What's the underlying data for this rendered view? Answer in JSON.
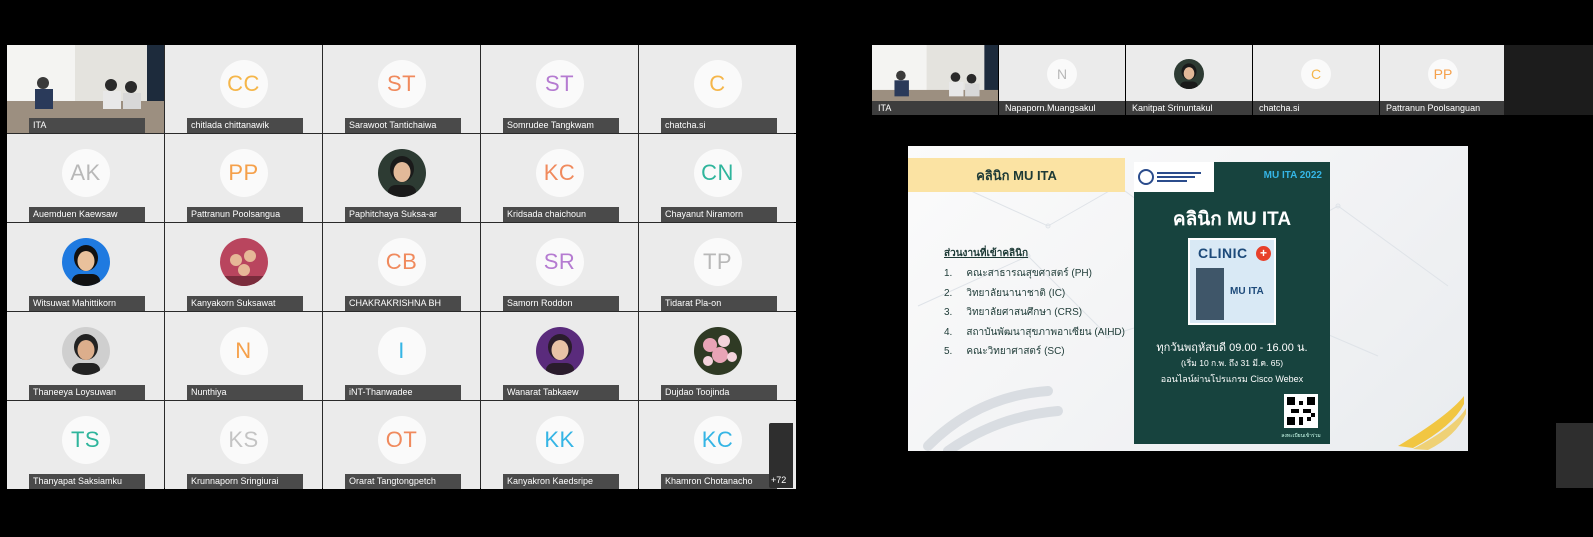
{
  "gallery": {
    "overflow_count": "+72",
    "tiles": [
      {
        "type": "video",
        "name": "ITA"
      },
      {
        "type": "initials",
        "initials": "CC",
        "color": "#f5b64a",
        "name": "chitlada chittanawik"
      },
      {
        "type": "initials",
        "initials": "ST",
        "color": "#f08a5d",
        "name": "Sarawoot Tantichaiwa"
      },
      {
        "type": "initials",
        "initials": "ST",
        "color": "#b57bd1",
        "name": "Somrudee Tangkwam"
      },
      {
        "type": "initials",
        "initials": "C",
        "color": "#f5b64a",
        "name": "chatcha.si"
      },
      {
        "type": "initials",
        "initials": "AK",
        "color": "#b8b8b8",
        "name": "Auemduen Kaewsaw"
      },
      {
        "type": "initials",
        "initials": "PP",
        "color": "#f5a04a",
        "name": "Pattranun Poolsangua"
      },
      {
        "type": "photo",
        "photo": "woman-portrait",
        "name": "Paphitchaya Suksa-ar"
      },
      {
        "type": "initials",
        "initials": "KC",
        "color": "#f08a5d",
        "name": "Kridsada chaichoun"
      },
      {
        "type": "initials",
        "initials": "CN",
        "color": "#2fb59c",
        "name": "Chayanut Niramorn"
      },
      {
        "type": "photo",
        "photo": "boy-blue-portrait",
        "name": "Witsuwat Mahittikorn"
      },
      {
        "type": "photo",
        "photo": "group-photo",
        "name": "Kanyakorn Suksawat"
      },
      {
        "type": "initials",
        "initials": "CB",
        "color": "#f08a5d",
        "name": "CHAKRAKRISHNA BH"
      },
      {
        "type": "initials",
        "initials": "SR",
        "color": "#b57bd1",
        "name": "Samorn Roddon"
      },
      {
        "type": "initials",
        "initials": "TP",
        "color": "#b8b8b8",
        "name": "Tidarat Pla-on"
      },
      {
        "type": "photo",
        "photo": "woman-glasses-portrait",
        "name": "Thaneeya Loysuwan"
      },
      {
        "type": "initials",
        "initials": "N",
        "color": "#f5a04a",
        "name": "Nunthiya"
      },
      {
        "type": "initials",
        "initials": "I",
        "color": "#35b5e5",
        "name": "iNT-Thanwadee"
      },
      {
        "type": "photo",
        "photo": "purple-stage-photo",
        "name": "Wanarat Tabkaew"
      },
      {
        "type": "photo",
        "photo": "pink-flowers-photo",
        "name": "Dujdao Toojinda"
      },
      {
        "type": "initials",
        "initials": "TS",
        "color": "#2fb59c",
        "name": "Thanyapat Saksiamku"
      },
      {
        "type": "initials",
        "initials": "KS",
        "color": "#c4c4c4",
        "name": "Krunnaporn Sringiurai"
      },
      {
        "type": "initials",
        "initials": "OT",
        "color": "#f08a5d",
        "name": "Orarat Tangtongpetch"
      },
      {
        "type": "initials",
        "initials": "KK",
        "color": "#35b5e5",
        "name": "Kanyakron Kaedsripe"
      },
      {
        "type": "initials",
        "initials": "KC",
        "color": "#35b5e5",
        "name": "Khamron Chotanacho"
      }
    ]
  },
  "filmstrip": [
    {
      "type": "video",
      "name": "ITA"
    },
    {
      "type": "initials",
      "initials": "N",
      "color": "#b8b8b8",
      "name": "Napaporn.Muangsakul"
    },
    {
      "type": "photo",
      "photo": "woman-portrait",
      "name": "Kanitpat Srinuntakul"
    },
    {
      "type": "initials",
      "initials": "C",
      "color": "#f5b64a",
      "name": "chatcha.si"
    },
    {
      "type": "initials",
      "initials": "PP",
      "color": "#f5a04a",
      "name": "Pattranun Poolsanguan"
    }
  ],
  "slide": {
    "banner_title": "คลินิก MU ITA",
    "units_title": "ส่วนงานที่เข้าคลินิก",
    "units": [
      {
        "num": "1.",
        "text": "คณะสาธารณสุขศาสตร์ (PH)"
      },
      {
        "num": "2.",
        "text": "วิทยาลัยนานาชาติ (IC)"
      },
      {
        "num": "3.",
        "text": "วิทยาลัยศาสนศึกษา (CRS)"
      },
      {
        "num": "4.",
        "text": "สถาบันพัฒนาสุขภาพอาเซียน (AIHD)"
      },
      {
        "num": "5.",
        "text": "คณะวิทยาศาสตร์ (SC)"
      }
    ],
    "card": {
      "tag": "MU ITA 2022",
      "title": "คลินิก MU ITA",
      "sign_word": "CLINIC",
      "sign_cross": "+",
      "sign_label": "MU ITA",
      "line1": "ทุกวันพฤหัสบดี 09.00 - 16.00 น.",
      "line2": "(เริ่ม 10 ก.พ. ถึง 31 มี.ค. 65)",
      "line3": "ออนไลน์ผ่านโปรแกรม Cisco Webex",
      "qr_caption": "ลงทะเบียนเข้าร่วม"
    },
    "colors": {
      "banner": "#fbe3a3",
      "card": "#17433e",
      "accent": "#35b5e5",
      "gold": "#f2c230"
    }
  }
}
